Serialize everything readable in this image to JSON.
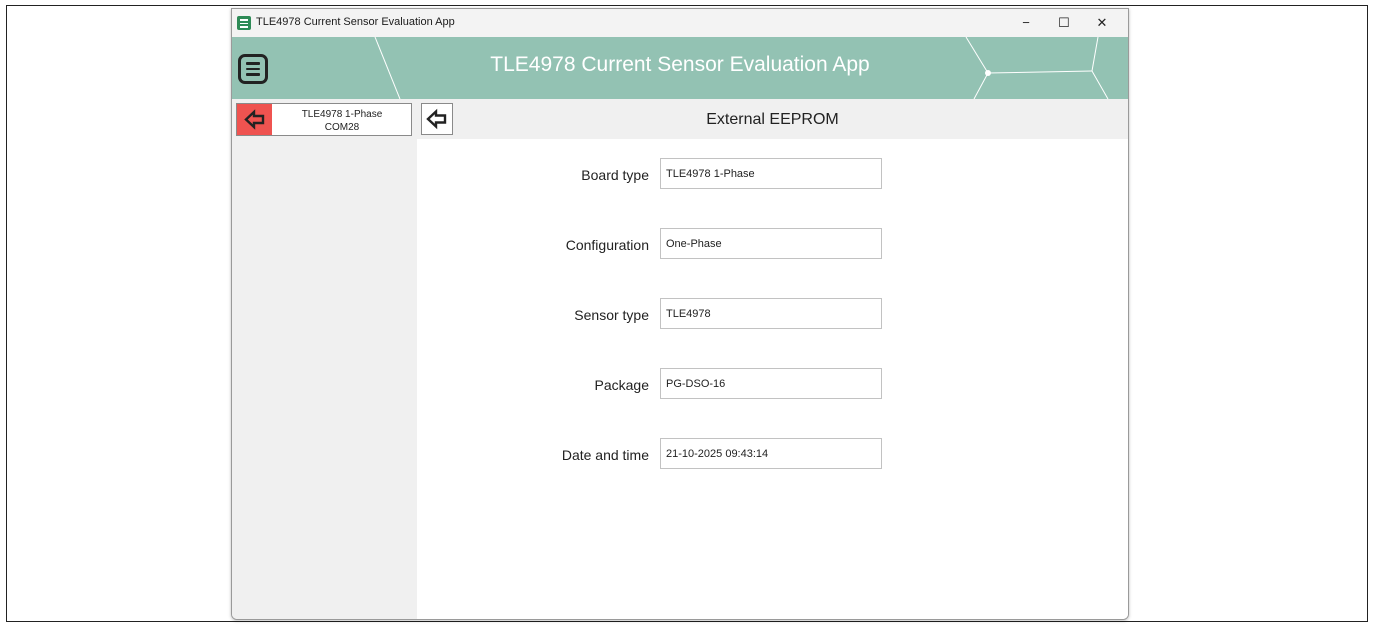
{
  "window": {
    "title": "TLE4978 Current Sensor Evaluation App",
    "minimize_glyph": "−",
    "maximize_glyph": "☐",
    "close_glyph": "✕"
  },
  "header": {
    "title": "TLE4978 Current Sensor Evaluation App",
    "background_color": "#93c2b3"
  },
  "sidebar": {
    "device": {
      "name": "TLE4978 1-Phase",
      "port": "COM28",
      "disconnect_color": "#ef5350"
    }
  },
  "main": {
    "title": "External EEPROM",
    "fields": [
      {
        "label": "Board type",
        "value": "TLE4978 1-Phase"
      },
      {
        "label": "Configuration",
        "value": "One-Phase"
      },
      {
        "label": "Sensor type",
        "value": "TLE4978"
      },
      {
        "label": "Package",
        "value": "PG-DSO-16"
      },
      {
        "label": "Date and time",
        "value": "21-10-2025 09:43:14"
      }
    ]
  },
  "icons": {
    "menu": "hamburger-menu-icon",
    "disconnect": "arrow-left-icon",
    "back": "arrow-left-icon"
  }
}
